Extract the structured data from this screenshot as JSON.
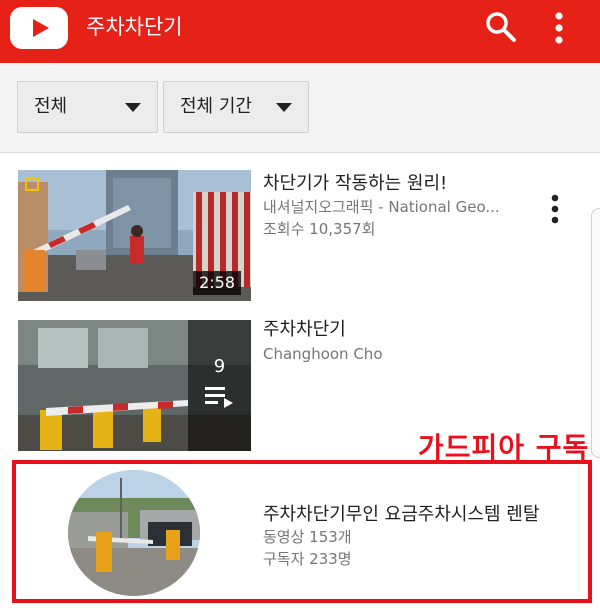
{
  "app": {
    "title": "주차차단기",
    "accent": "#e62117"
  },
  "icons": {
    "logo": "youtube-play-logo",
    "search": "search-icon",
    "more": "more-vert-icon",
    "caret": "caret-down-icon",
    "playlist": "playlist-icon"
  },
  "filters": [
    {
      "label": "전체"
    },
    {
      "label": "전체 기간"
    }
  ],
  "results": [
    {
      "type": "video",
      "title": "차단기가 작동하는 원리!",
      "channel": "내셔널지오그래픽 - National Geo...",
      "views": "조회수 10,357회",
      "duration": "2:58"
    },
    {
      "type": "playlist",
      "title": "주차차단기",
      "channel": "Changhoon Cho",
      "count": "9"
    }
  ],
  "channel_result": {
    "promo_label": "가드피아 구독",
    "highlight_color": "#e8111b",
    "title": "주차차단기무인 요금주차시스템 렌탈",
    "videos": "동영상 153개",
    "subscribers": "구독자 233명"
  }
}
